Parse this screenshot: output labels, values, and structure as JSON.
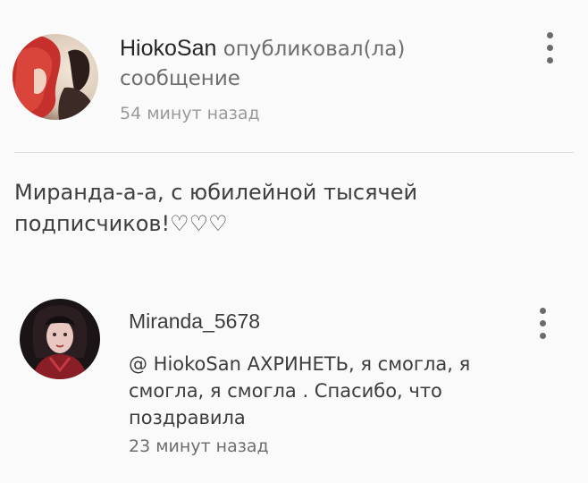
{
  "post": {
    "author": "HiokoSan",
    "action_line1": " опубликовал(ла)",
    "action_line2": "сообщение",
    "time": "54 минут назад",
    "body": "Миранда-а-а, с юбилейной тысячей подписчиков!♡♡♡"
  },
  "reply": {
    "author": "Miranda_5678",
    "text": "@ HiokoSan  АХРИНЕТЬ, я смогла, я смогла, я смогла . Спасибо, что поздравила",
    "time": "23 минут назад"
  },
  "icons": {
    "menu_post": "more-vertical-icon",
    "menu_reply": "more-vertical-icon"
  }
}
